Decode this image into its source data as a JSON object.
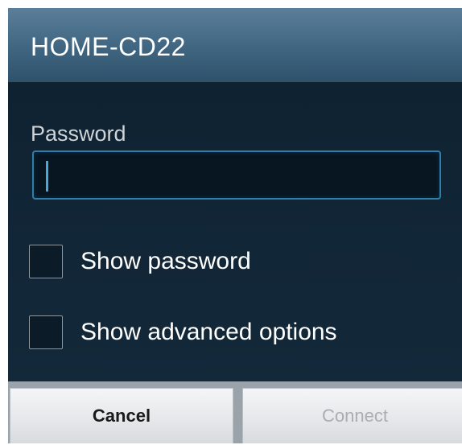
{
  "dialog": {
    "title": "HOME-CD22"
  },
  "password": {
    "label": "Password",
    "value": ""
  },
  "options": [
    {
      "label": "Show password",
      "checked": false
    },
    {
      "label": "Show advanced options",
      "checked": false
    }
  ],
  "buttons": {
    "cancel_label": "Cancel",
    "connect_label": "Connect",
    "connect_enabled": false
  },
  "colors": {
    "title_bar": "#3f6580",
    "dialog_background": "#132838",
    "input_border_focus": "#2f7da8",
    "caret": "#47a9d9"
  }
}
